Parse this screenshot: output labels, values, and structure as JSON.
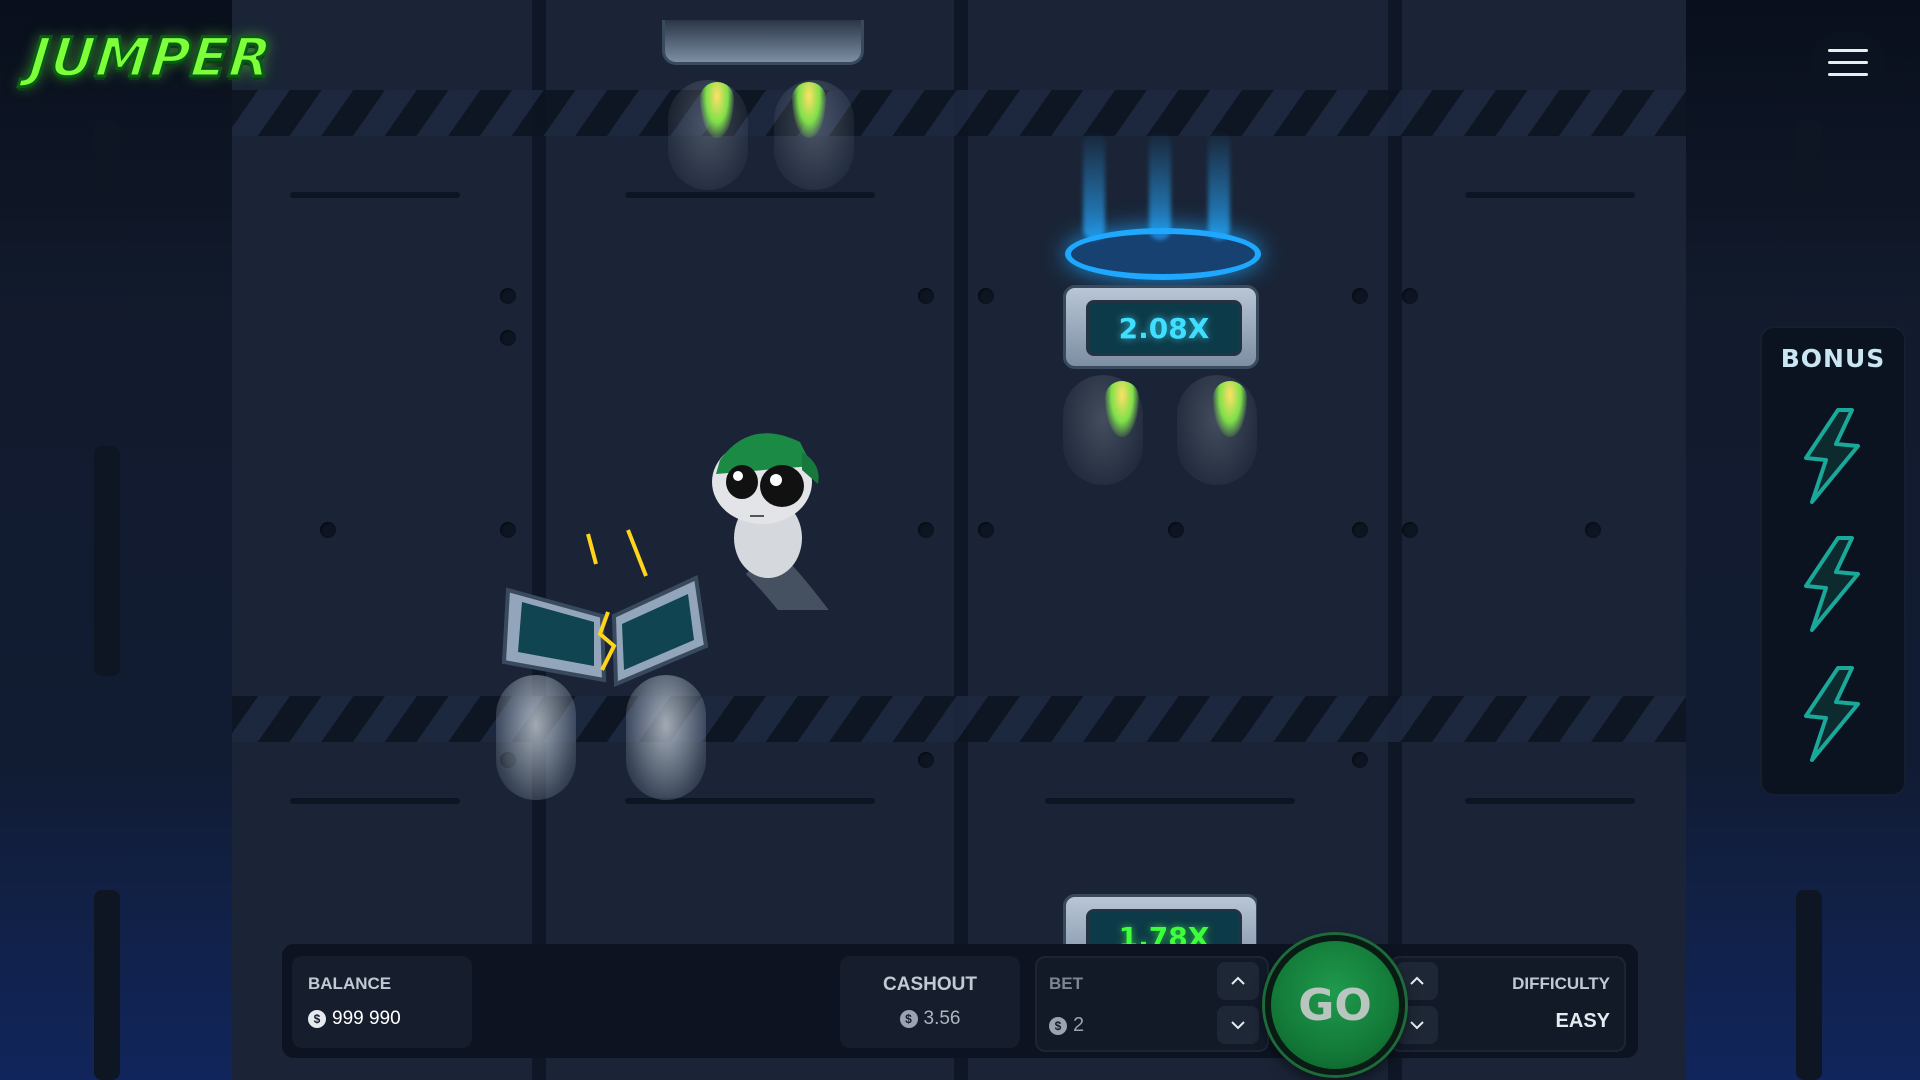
{
  "app": {
    "logo_text": "JUMPER"
  },
  "header": {
    "menu_icon": "hamburger-menu-icon"
  },
  "game": {
    "platforms": [
      {
        "multiplier": "2.08X",
        "state": "active-target",
        "color": "#3fe0ff"
      },
      {
        "multiplier": "1.78X",
        "state": "next",
        "color": "#3dff3a"
      }
    ],
    "character": "alien-with-green-cap",
    "broken_platform": "cracked-platform"
  },
  "bonus": {
    "title": "BONUS",
    "slots": [
      "lightning-bolt-icon",
      "lightning-bolt-icon",
      "lightning-bolt-icon"
    ]
  },
  "hud": {
    "balance": {
      "label": "BALANCE",
      "currency_icon": "dollar-coin-icon",
      "value": "999 990"
    },
    "cashout": {
      "label": "CASHOUT",
      "currency_icon": "dollar-coin-icon",
      "value": "3.56"
    },
    "bet": {
      "label": "BET",
      "currency_icon": "dollar-coin-icon",
      "value": "2"
    },
    "go_label": "GO",
    "difficulty": {
      "label": "DIFFICULTY",
      "value": "EASY"
    }
  },
  "colors": {
    "accent_green": "#1f9a4d",
    "logo_green": "#7dff3a",
    "cyan": "#3fe0ff",
    "bonus_bolt": "#1aa89a"
  }
}
